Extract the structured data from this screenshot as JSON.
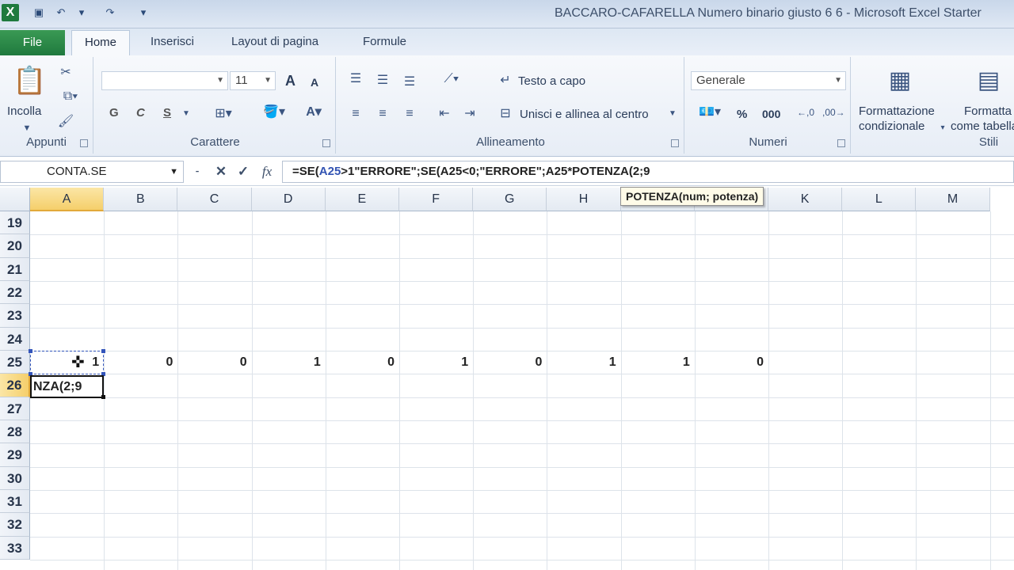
{
  "app": {
    "title": "BACCARO-CAFARELLA Numero binario giusto 6 6 - Microsoft Excel Starter",
    "logo": "X"
  },
  "tabs": [
    "File",
    "Home",
    "Inserisci",
    "Layout di pagina",
    "Formule"
  ],
  "ribbon": {
    "clipboard": {
      "label": "Appunti",
      "paste": "Incolla"
    },
    "font": {
      "label": "Carattere",
      "size": "11",
      "bold": "G",
      "italic": "C",
      "underline": "S",
      "grow": "A",
      "shrink": "A"
    },
    "alignment": {
      "label": "Allineamento",
      "wrap": "Testo a capo",
      "merge": "Unisci e allinea al centro"
    },
    "number": {
      "label": "Numeri",
      "format": "Generale",
      "percent": "%",
      "thousands": "000"
    },
    "styles": {
      "label": "Stili",
      "conditional_line1": "Formattazione",
      "conditional_line2": "condizionale",
      "table_line1": "Formatta",
      "table_line2": "come tabella"
    }
  },
  "formula_bar": {
    "name_box": "CONTA.SE",
    "formula_prefix": "=SE(",
    "formula_ref": "A25",
    "formula_rest": ">1\"ERRORE\";SE(A25<0;\"ERRORE\";A25*POTENZA(",
    "formula_tail": "2;9"
  },
  "grid": {
    "columns": [
      "A",
      "B",
      "C",
      "D",
      "E",
      "F",
      "G",
      "H",
      "I",
      "J",
      "K",
      "L",
      "M"
    ],
    "rows": [
      "19",
      "20",
      "21",
      "22",
      "23",
      "24",
      "25",
      "26",
      "27",
      "28",
      "29",
      "30",
      "31",
      "32",
      "33"
    ],
    "selected_column": "A",
    "selected_row": "26",
    "row25_values": [
      "1",
      "0",
      "0",
      "1",
      "0",
      "1",
      "0",
      "1",
      "1",
      "0"
    ],
    "editing_cell_text": "NZA(2;9",
    "tooltip": "POTENZA(num; potenza)"
  }
}
